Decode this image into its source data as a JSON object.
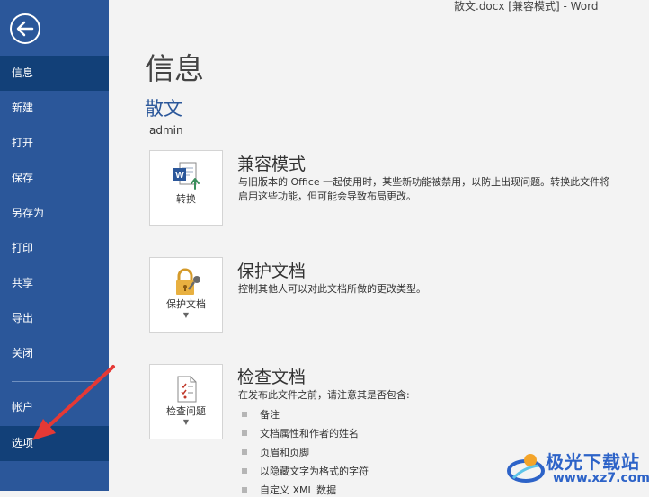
{
  "window": {
    "title": "散文.docx [兼容模式] - Word"
  },
  "sidebar": {
    "items": [
      {
        "label": "信息",
        "selected": true
      },
      {
        "label": "新建"
      },
      {
        "label": "打开"
      },
      {
        "label": "保存"
      },
      {
        "label": "另存为"
      },
      {
        "label": "打印"
      },
      {
        "label": "共享"
      },
      {
        "label": "导出"
      },
      {
        "label": "关闭"
      },
      {
        "label": "帐户"
      },
      {
        "label": "选项",
        "selected": true
      }
    ],
    "colors": {
      "background": "#2b579a",
      "selected": "#124078"
    }
  },
  "main": {
    "title": "信息",
    "doc_name": "散文",
    "author": "admin",
    "sections": [
      {
        "button_label": "转换",
        "icon": "word-convert-icon",
        "title": "兼容模式",
        "description": "与旧版本的 Office 一起使用时，某些新功能被禁用，以防止出现问题。转换此文件将\n启用这些功能，但可能会导致布局更改。"
      },
      {
        "button_label": "保护文档",
        "icon": "lock-key-icon",
        "title": "保护文档",
        "description": "控制其他人可以对此文档所做的更改类型。"
      },
      {
        "button_label": "检查问题",
        "icon": "checklist-icon",
        "title": "检查文档",
        "description": "在发布此文件之前，请注意其是否包含:",
        "bullets": [
          "备注",
          "文档属性和作者的姓名",
          "页眉和页脚",
          "以隐藏文字为格式的字符",
          "自定义 XML 数据"
        ]
      }
    ]
  },
  "watermark": {
    "text": "极光下载站",
    "url": "www.xz7.com"
  }
}
